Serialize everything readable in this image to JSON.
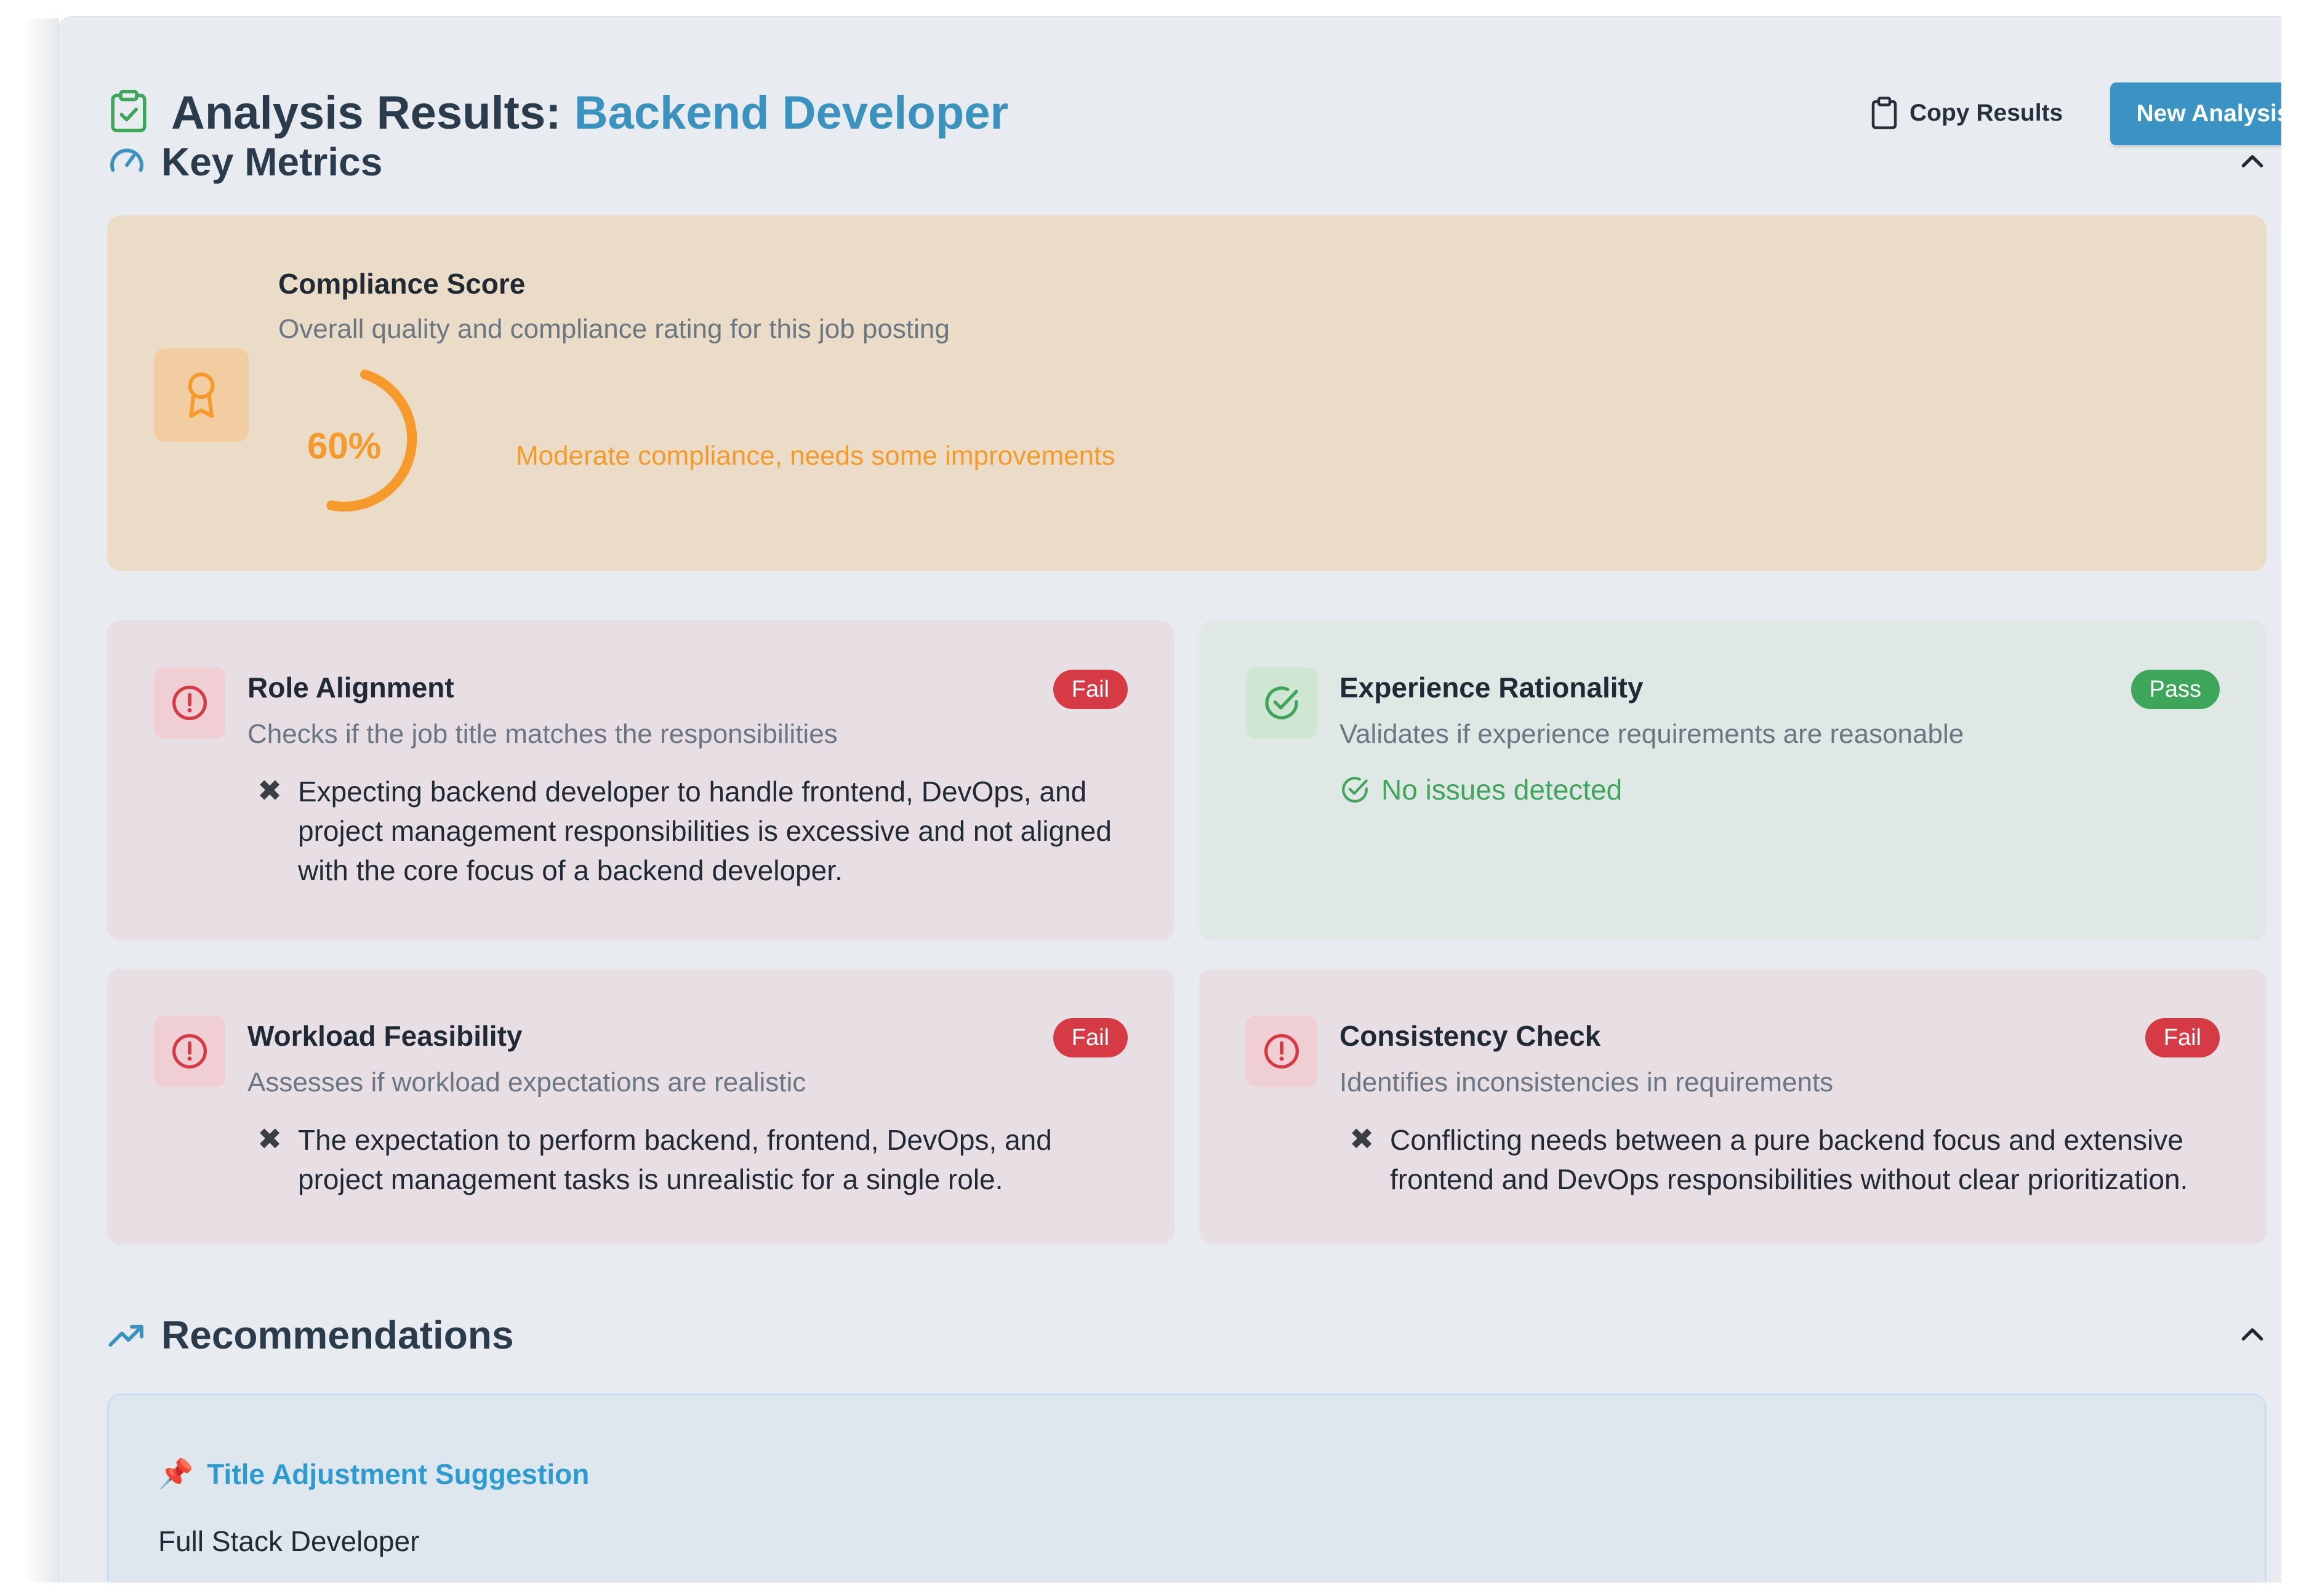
{
  "header": {
    "title_prefix": "Analysis Results: ",
    "title_role": "Backend Developer",
    "copy_label": "Copy Results",
    "new_label": "New Analysis"
  },
  "key_metrics": {
    "heading": "Key Metrics",
    "compliance": {
      "title": "Compliance Score",
      "subtitle": "Overall quality and compliance rating for this job posting",
      "score_text": "60%",
      "score_fraction": 0.6,
      "description": "Moderate compliance, needs some improvements"
    },
    "cards": [
      {
        "title": "Role Alignment",
        "subtitle": "Checks if the job title matches the responsibilities",
        "status": "Fail",
        "issue": "Expecting backend developer to handle frontend, DevOps, and project management responsibilities is excessive and not aligned with the core focus of a backend developer."
      },
      {
        "title": "Experience Rationality",
        "subtitle": "Validates if experience requirements are reasonable",
        "status": "Pass",
        "ok_text": "No issues detected"
      },
      {
        "title": "Workload Feasibility",
        "subtitle": "Assesses if workload expectations are realistic",
        "status": "Fail",
        "issue": "The expectation to perform backend, frontend, DevOps, and project management tasks is unrealistic for a single role."
      },
      {
        "title": "Consistency Check",
        "subtitle": "Identifies inconsistencies in requirements",
        "status": "Fail",
        "issue": "Conflicting needs between a pure backend focus and extensive frontend and DevOps responsibilities without clear prioritization."
      }
    ]
  },
  "recommendations": {
    "heading": "Recommendations",
    "item_title": "Title Adjustment Suggestion",
    "item_body": "Full Stack Developer"
  },
  "colors": {
    "accent": "#3a92be",
    "warning": "#f59a2b",
    "fail": "#d63a44",
    "pass": "#3ea65a",
    "rec_title": "#2b9bd0"
  },
  "icons": {
    "title": "clipboard-check-icon",
    "metrics": "gauge-icon",
    "compliance": "award-icon",
    "fail": "alert-circle-icon",
    "pass": "check-circle-icon",
    "recommendations": "trending-up-icon",
    "recommendation_item": "pushpin-icon",
    "issue": "x-mark-icon"
  }
}
